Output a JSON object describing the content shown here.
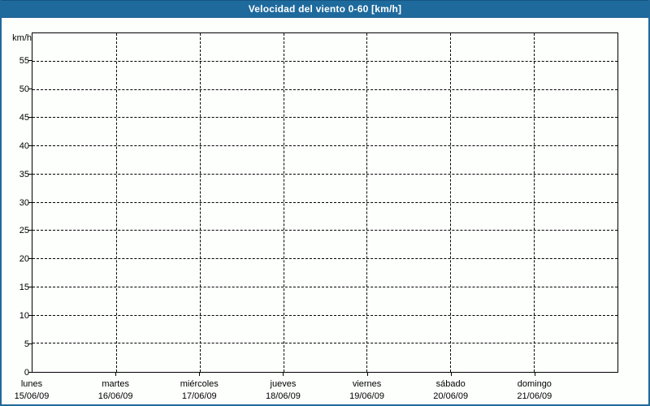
{
  "titlebar": {
    "title": "Velocidad del viento 0-60 [km/h]"
  },
  "colors": {
    "titlebar_bg": "#1e6a9d",
    "titlebar_text": "#ffffff",
    "page_border": "#21689b",
    "background": "#fdfffd",
    "plot_border": "#000000",
    "grid": "#000000",
    "label_text": "#000000"
  },
  "chart_data": {
    "type": "line",
    "title": "Velocidad del viento 0-60 [km/h]",
    "ylabel": "km/h",
    "ylim": [
      0,
      60
    ],
    "ytick_step": 5,
    "yticks": [
      0,
      5,
      10,
      15,
      20,
      25,
      30,
      35,
      40,
      45,
      50,
      55
    ],
    "categories": [
      "lunes",
      "martes",
      "miércoles",
      "jueves",
      "viernes",
      "sábado",
      "domingo"
    ],
    "x_dates": [
      "15/06/09",
      "16/06/09",
      "17/06/09",
      "18/06/09",
      "19/06/09",
      "20/06/09",
      "21/06/09"
    ],
    "series": [],
    "grid": "dashed",
    "legend": "none"
  }
}
